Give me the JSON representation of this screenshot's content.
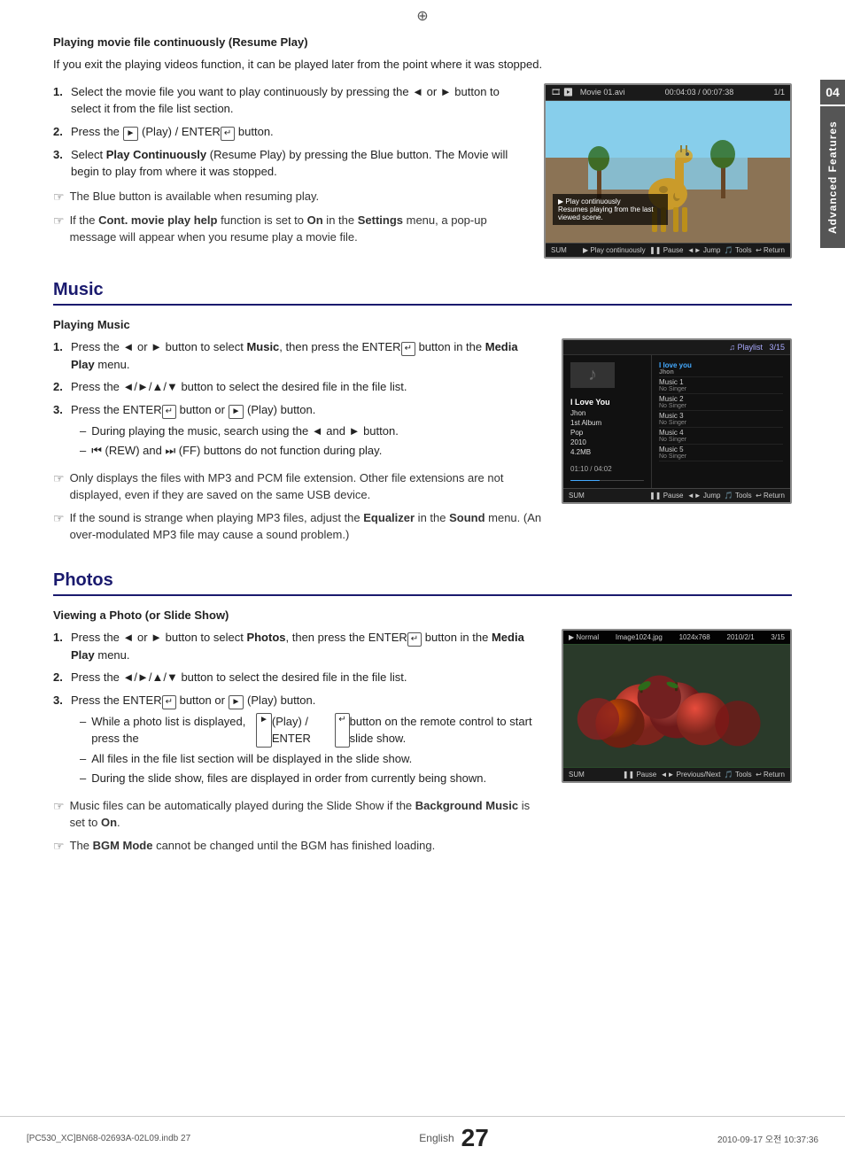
{
  "page": {
    "chapter": "04",
    "chapter_label": "Advanced Features",
    "top_symbol": "⊕",
    "bottom_symbol": "⊕"
  },
  "resume_play_section": {
    "title": "Playing movie file continuously (Resume Play)",
    "intro": "If you exit the playing videos function, it can be played later from the point where it was stopped.",
    "steps": [
      {
        "num": "1.",
        "text": "Select the movie file you want to play continuously by pressing the ◄ or ► button to select it from the file list section."
      },
      {
        "num": "2.",
        "text": "Press the [►] (Play) / ENTER↵ button."
      },
      {
        "num": "3.",
        "text": "Select Play Continuously (Resume Play) by pressing the Blue button. The Movie will begin to play from where it was stopped."
      }
    ],
    "notes": [
      "The Blue button is available when resuming play.",
      "If the Cont. movie play help function is set to On in the Settings menu, a pop-up message will appear when you resume play a movie file."
    ],
    "screen": {
      "header_left": "🎞 ▶",
      "header_file": "Movie 01.avi",
      "header_time": "00:04:03 / 00:07:38",
      "header_count": "1/1",
      "overlay_line1": "▶ Play continuously",
      "overlay_line2": "Resumes playing from the last viewed scene.",
      "footer_left": "SUM",
      "footer_controls": "▶ Play continuously  ❚❚ Pause  ◄► Jump  🎵 Tools  ↩ Return"
    }
  },
  "music_section": {
    "title": "Music",
    "subsection_title": "Playing Music",
    "steps": [
      {
        "num": "1.",
        "text": "Press the ◄ or ► button to select Music, then press the ENTER↵ button in the Media Play menu."
      },
      {
        "num": "2.",
        "text": "Press the ◄/►/▲/▼ button to select the desired file in the file list."
      },
      {
        "num": "3.",
        "text": "Press the ENTER↵ button or [►] (Play) button.",
        "subitems": [
          "During playing the music, search using the ◄ and ► button.",
          "(REW) and (FF) buttons do not function during play."
        ]
      }
    ],
    "notes": [
      "Only displays the files with MP3 and PCM file extension. Other file extensions are not displayed, even if they are saved on the same USB device.",
      "If the sound is strange when playing MP3 files, adjust the Equalizer in the Sound menu. (An over-modulated MP3 file may cause a sound problem.)"
    ],
    "screen": {
      "header_left": "♫ Playlist",
      "header_count": "3/15",
      "song_title": "I Love You",
      "artist": "Jhon",
      "album": "1st Album",
      "genre": "Pop",
      "year": "2010",
      "size": "4.2MB",
      "time": "01:10 / 04:02",
      "playlist": [
        {
          "title": "I love you",
          "singer": "Jhon",
          "active": true
        },
        {
          "title": "Music 1",
          "singer": "No Singer",
          "active": false
        },
        {
          "title": "Music 2",
          "singer": "No Singer",
          "active": false
        },
        {
          "title": "Music 3",
          "singer": "No Singer",
          "active": false
        },
        {
          "title": "Music 4",
          "singer": "No Singer",
          "active": false
        },
        {
          "title": "Music 5",
          "singer": "No Singer",
          "active": false
        }
      ],
      "footer_left": "SUM",
      "footer_controls": "❚❚ Pause  ◄► Jump  🎵 Tools  ↩ Return"
    }
  },
  "photos_section": {
    "title": "Photos",
    "subsection_title": "Viewing a Photo (or Slide Show)",
    "steps": [
      {
        "num": "1.",
        "text": "Press the ◄ or ► button to select Photos, then press the ENTER↵ button in the Media Play menu."
      },
      {
        "num": "2.",
        "text": "Press the ◄/►/▲/▼ button to select the desired file in the file list."
      },
      {
        "num": "3.",
        "text": "Press the ENTER↵ button or [►] (Play) button.",
        "subitems": [
          "While a photo list is displayed, press the [►] (Play) / ENTER↵ button on the remote control to start slide show.",
          "All files in the file list section will be displayed in the slide show.",
          "During the slide show, files are displayed in order from currently being shown."
        ]
      }
    ],
    "notes": [
      "Music files can be automatically played during the Slide Show if the Background Music is set to On.",
      "The BGM Mode cannot be changed until the BGM has finished loading."
    ],
    "screen": {
      "mode": "▶ Normal",
      "filename": "Image1024.jpg",
      "resolution": "1024x768",
      "date": "2010/2/1",
      "count": "3/15",
      "footer_left": "SUM",
      "footer_controls": "❚❚ Pause  ◄► Previous/Next  🎵 Tools  ↩ Return"
    }
  },
  "footer": {
    "file_info": "[PC530_XC]BN68-02693A-02L09.indb   27",
    "date": "2010-09-17   오전 10:37:36",
    "english_label": "English",
    "page_number": "27"
  }
}
